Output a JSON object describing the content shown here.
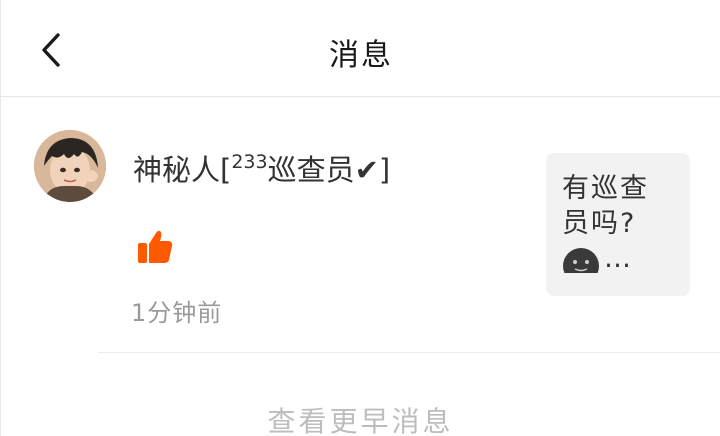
{
  "navbar": {
    "back_icon": "chevron-left-icon",
    "title": "消息"
  },
  "notification": {
    "avatar": "user-avatar",
    "username_prefix": "神秘人[",
    "username_sup": "233",
    "username_suffix": "巡查员✔]",
    "action_icon": "thumbs-up-icon",
    "action_icon_color": "#ff5a00",
    "time": "1分钟前",
    "quote": {
      "text": "有巡查员吗?",
      "emoji": "dark-face-emoji",
      "ellipsis": "…"
    }
  },
  "footer": {
    "more_label": "查看更早消息"
  }
}
